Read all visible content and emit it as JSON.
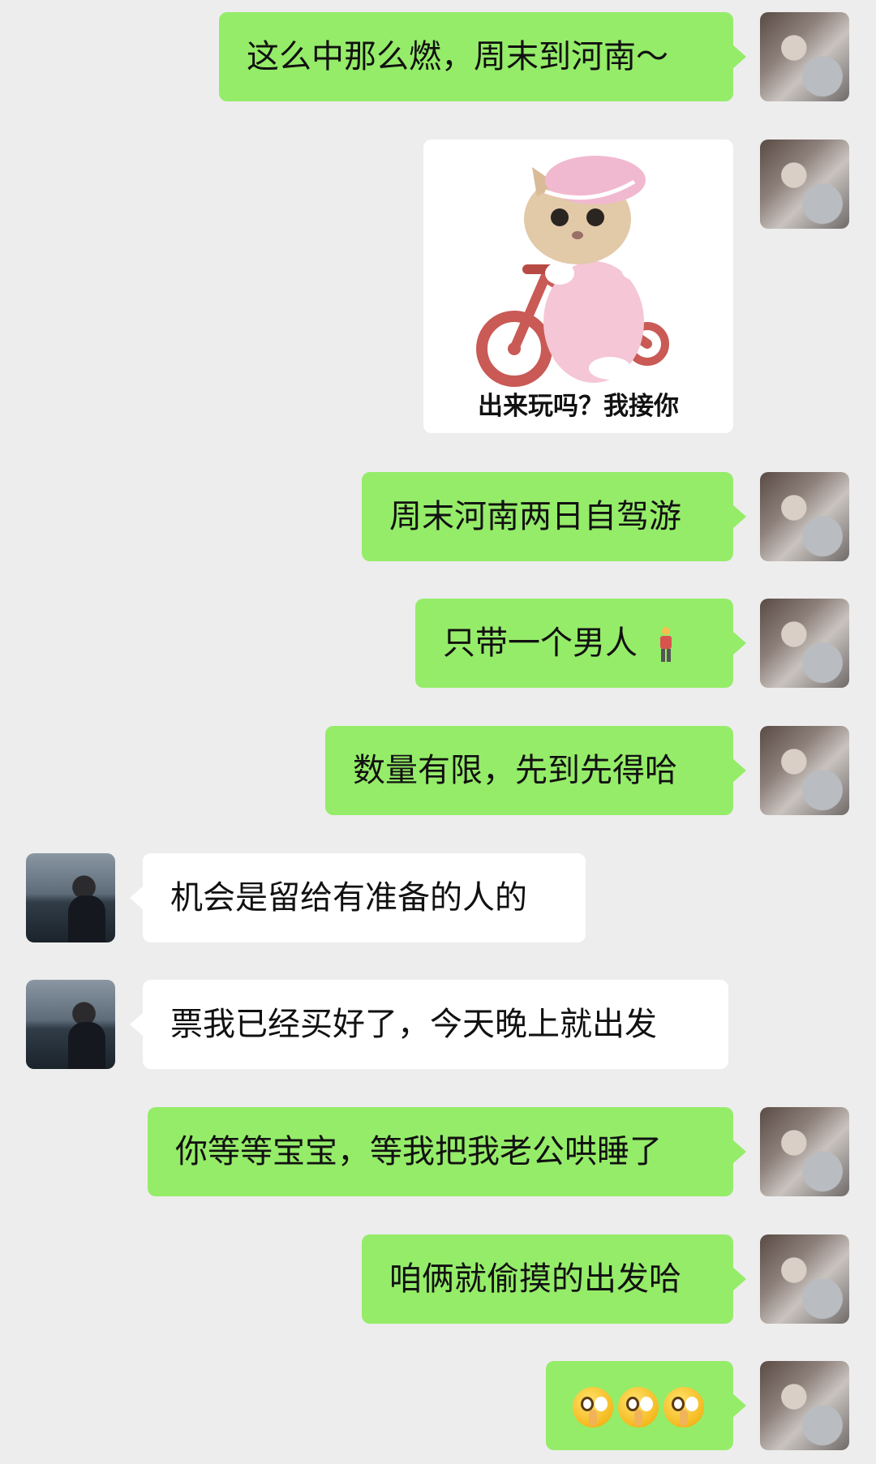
{
  "messages": [
    {
      "sender": "me",
      "type": "text",
      "text": "这么中那么燃，周末到河南～"
    },
    {
      "sender": "me",
      "type": "sticker",
      "caption": "出来玩吗？我接你"
    },
    {
      "sender": "me",
      "type": "text",
      "text": "周末河南两日自驾游"
    },
    {
      "sender": "me",
      "type": "text",
      "text": "只带一个男人",
      "emoji": "man-standing-emoji"
    },
    {
      "sender": "me",
      "type": "text",
      "text": "数量有限，先到先得哈"
    },
    {
      "sender": "other",
      "type": "text",
      "text": "机会是留给有准备的人的"
    },
    {
      "sender": "other",
      "type": "text",
      "text": "票我已经买好了，今天晚上就出发"
    },
    {
      "sender": "me",
      "type": "text",
      "text": "你等等宝宝，等我把我老公哄睡了"
    },
    {
      "sender": "me",
      "type": "text",
      "text": "咱俩就偷摸的出发哈"
    },
    {
      "sender": "me",
      "type": "emoji",
      "emoji": "shushing-face-emoji",
      "count": 3
    }
  ],
  "colors": {
    "my_bubble": "#95ec69",
    "their_bubble": "#ffffff",
    "background": "#ededed"
  }
}
